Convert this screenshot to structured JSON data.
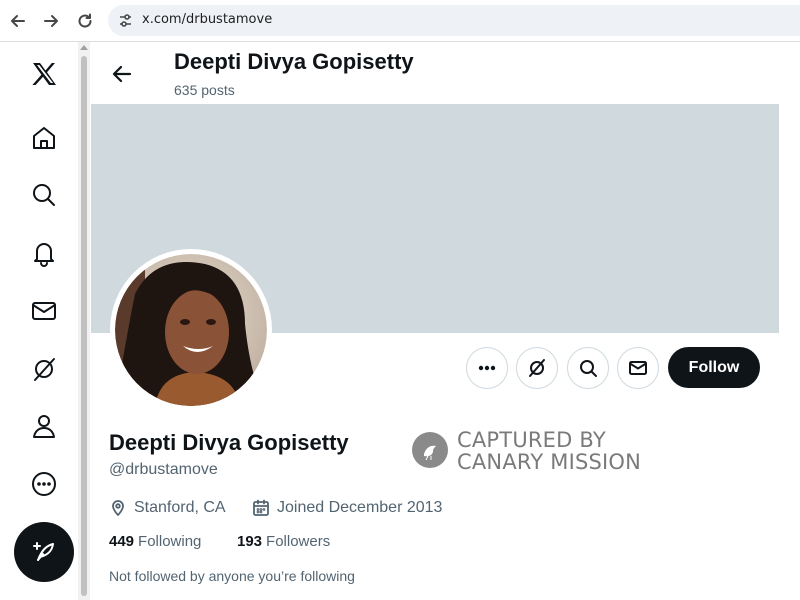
{
  "browser": {
    "url": "x.com/drbustamove",
    "back_icon": "arrow-left-icon",
    "forward_icon": "arrow-right-icon",
    "reload_icon": "reload-icon",
    "site_info_icon": "tune-icon"
  },
  "sidebar": {
    "items": [
      {
        "icon": "x-logo-icon"
      },
      {
        "icon": "home-icon"
      },
      {
        "icon": "search-icon"
      },
      {
        "icon": "bell-icon"
      },
      {
        "icon": "mail-icon"
      },
      {
        "icon": "grok-icon"
      },
      {
        "icon": "profile-icon"
      },
      {
        "icon": "more-icon"
      }
    ],
    "compose_icon": "feather-plus-icon"
  },
  "header": {
    "name": "Deepti Divya Gopisetty",
    "posts": "635 posts"
  },
  "banner": {
    "color": "#cfd9de"
  },
  "profile": {
    "name": "Deepti Divya Gopisetty",
    "handle": "@drbustamove",
    "location": "Stanford, CA",
    "joined": "Joined December 2013",
    "following_count": "449",
    "following_label": "Following",
    "followers_count": "193",
    "followers_label": "Followers",
    "not_followed": "Not followed by anyone you’re following"
  },
  "actions": {
    "follow_label": "Follow",
    "buttons": [
      "more-icon",
      "grok-icon",
      "search-icon",
      "mail-icon"
    ]
  },
  "watermark": {
    "line1": "CAPTURED BY",
    "line2": "CANARY MISSION"
  },
  "colors": {
    "text": "#0f1419",
    "secondary": "#536471",
    "banner": "#cfd9de",
    "button_dark": "#0f1419"
  }
}
